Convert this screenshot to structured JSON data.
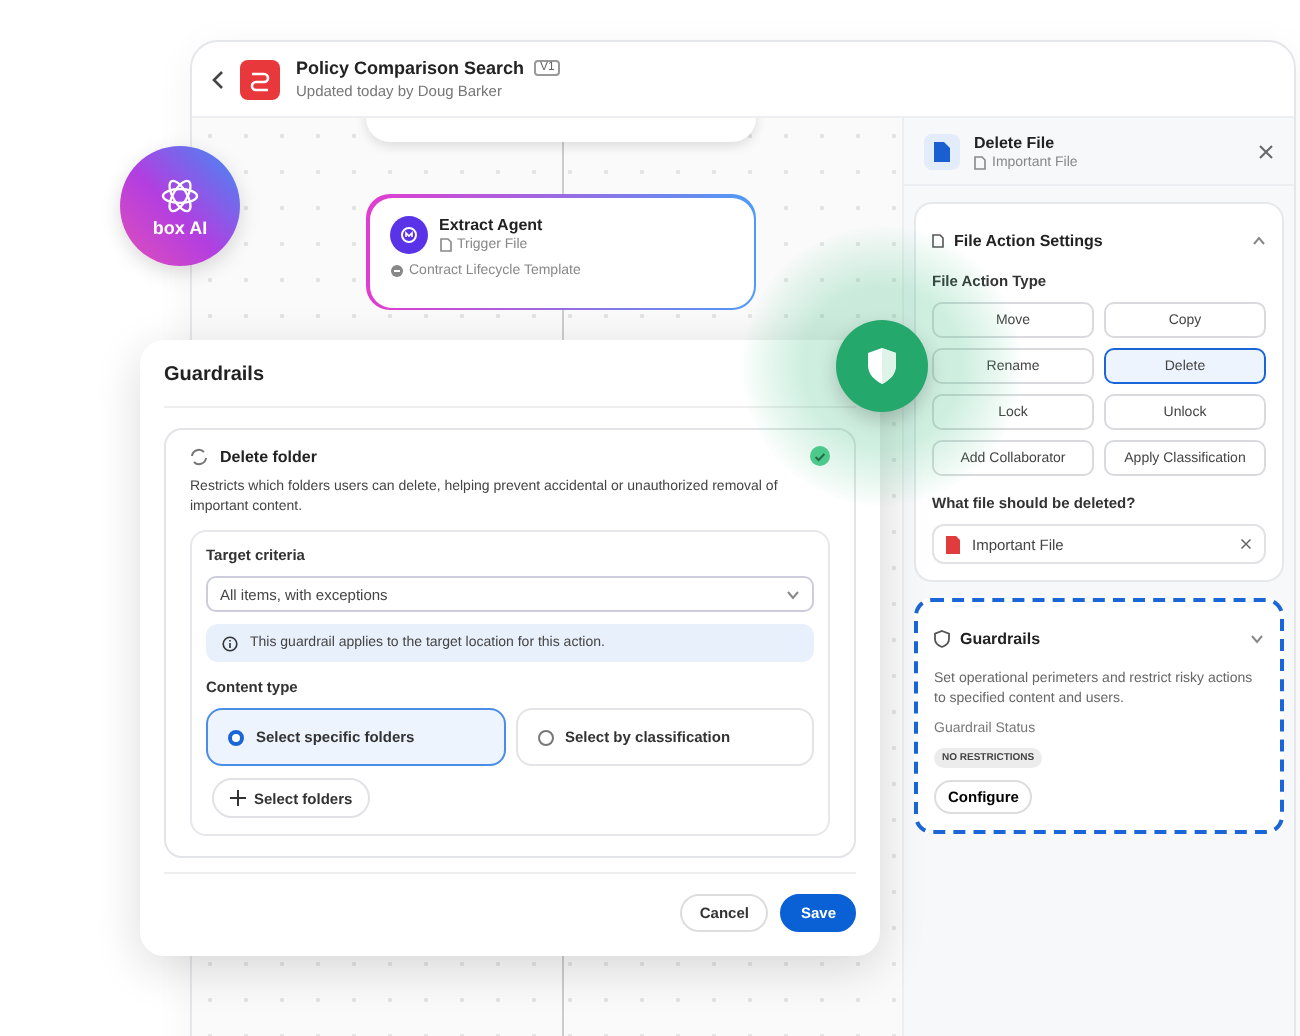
{
  "header": {
    "title": "Policy Comparison Search",
    "version": "V1",
    "subtitle": "Updated today by Doug Barker"
  },
  "badge": {
    "label": "box AI"
  },
  "agent_node": {
    "title": "Extract Agent",
    "subtitle": "Trigger File",
    "template": "Contract Lifecycle Template"
  },
  "panel": {
    "title": "Delete File",
    "file": "Important File",
    "settings": {
      "title": "File Action Settings",
      "expanded": true,
      "type_label": "File Action Type",
      "actions": [
        {
          "label": "Move",
          "selected": false
        },
        {
          "label": "Copy",
          "selected": false
        },
        {
          "label": "Rename",
          "selected": false
        },
        {
          "label": "Delete",
          "selected": true
        },
        {
          "label": "Lock",
          "selected": false
        },
        {
          "label": "Unlock",
          "selected": false
        },
        {
          "label": "Add Collaborator",
          "selected": false
        },
        {
          "label": "Apply Classification",
          "selected": false
        }
      ],
      "question": "What file should be deleted?",
      "file": "Important File"
    },
    "guardrails": {
      "title": "Guardrails",
      "expanded": false,
      "description": "Set operational perimeters and restrict risky actions to specified content and users.",
      "status_label": "Guardrail Status",
      "status": "NO RESTRICTIONS",
      "button": "Configure"
    }
  },
  "modal": {
    "title": "Guardrails",
    "rule": {
      "name": "Delete folder",
      "enabled": true,
      "description": "Restricts which folders users can delete, helping prevent accidental or unauthorized removal of important content.",
      "target_label": "Target criteria",
      "target_value": "All items, with exceptions",
      "info": "This guardrail applies to the target location for this action.",
      "content_label": "Content type",
      "options": [
        {
          "label": "Select specific folders",
          "selected": true
        },
        {
          "label": "Select by classification",
          "selected": false
        }
      ],
      "add_button": "Select folders"
    },
    "buttons": [
      {
        "label": "Cancel",
        "kind": "secondary"
      },
      {
        "label": "Save",
        "kind": "primary"
      }
    ]
  }
}
